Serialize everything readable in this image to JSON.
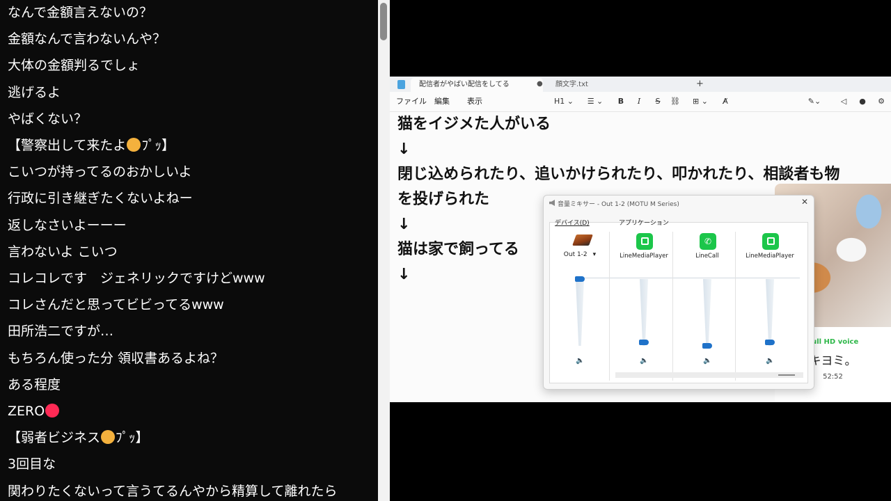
{
  "chat": {
    "messages": [
      {
        "text": "なんで金額言えないの？"
      },
      {
        "text": "金額なんで言わないんや？"
      },
      {
        "text": "大体の金額判るでしょ"
      },
      {
        "text": "逃げるよ"
      },
      {
        "text": "やばくない？"
      },
      {
        "text": "【警察出して来たよ",
        "emoji": "face-icon",
        "suffix": "ﾌﾟｯ】"
      },
      {
        "text": "こいつが持ってるのおかしいよ"
      },
      {
        "text": "行政に引き継ぎたくないよねー"
      },
      {
        "text": "返しなさいよーーー"
      },
      {
        "text": "言わないよ こいつ"
      },
      {
        "text": "コレコレです　ジェネリックですけどwww"
      },
      {
        "text": "コレさんだと思ってビビってるwww"
      },
      {
        "text": "田所浩二ですが…"
      },
      {
        "text": "もちろん使った分 領収書あるよね？"
      },
      {
        "text": "ある程度"
      },
      {
        "text": "ZERO",
        "emoji": "fire-icon",
        "suffix": ""
      },
      {
        "text": "【弱者ビジネス",
        "emoji": "face-icon",
        "suffix": "ﾌﾟｯ】"
      },
      {
        "text": "3回目な"
      },
      {
        "text": "関わりたくないって言うてるんやから精算して離れたら"
      }
    ]
  },
  "notepad": {
    "tab1_label": "配信者がやばい配信をしてる",
    "tab1_modified": "●",
    "tab2_label": "顔文字.txt",
    "new_tab": "+",
    "menu": {
      "file": "ファイル",
      "edit": "編集",
      "view": "表示"
    },
    "toolbar": {
      "heading": "H1 ⌄",
      "list": "☰ ⌄",
      "bold": "B",
      "italic": "I",
      "strike": "S",
      "link": "⛓",
      "table": "⊞ ⌄",
      "clear": "A̸"
    },
    "lines": [
      "猫をイジメた人がいる",
      "↓",
      "閉じ込められたり、追いかけられたり、叩かれたり、相談者も物",
      "を投げられた",
      "↓",
      "猫は家で飼ってる",
      "↓"
    ]
  },
  "mixer": {
    "title": "音量ミキサー - Out 1-2 (MOTU M Series)",
    "close": "✕",
    "device_heading": "デバイス(D)",
    "apps_heading": "アプリケーション",
    "device_name": "Out 1-2",
    "device_arrow": "▾",
    "columns": [
      {
        "name": "",
        "level": 1.0
      },
      {
        "name": "LineMediaPlayer",
        "level": 0.05
      },
      {
        "name": "LineCall",
        "level": 0.0
      },
      {
        "name": "LineMediaPlayer",
        "level": 0.05
      }
    ],
    "speaker_glyph": "🔈"
  },
  "webcam": {
    "voice_label": "Full HD voice",
    "name": "キヨミ。",
    "time": "52:52"
  },
  "colors": {
    "accent": "#1f72c9",
    "line_green": "#1cc64a",
    "chat_bg": "#0b0b0b"
  }
}
